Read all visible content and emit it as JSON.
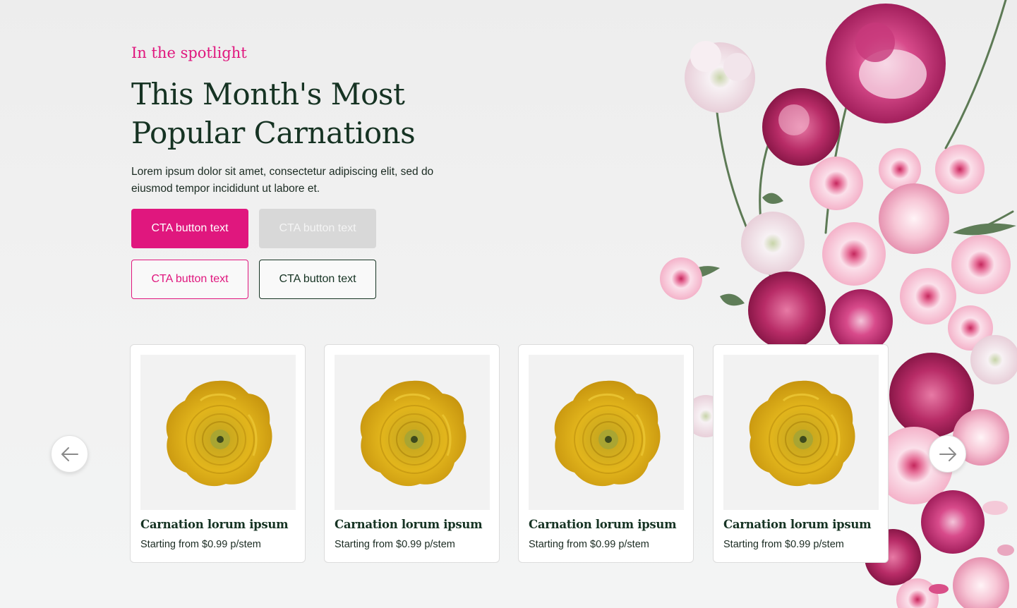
{
  "hero": {
    "eyebrow": "In the spotlight",
    "headline": "This Month's Most Popular Carnations",
    "description": "Lorem ipsum dolor sit amet, consectetur adipiscing elit, sed do eiusmod tempor incididunt ut labore et."
  },
  "buttons": {
    "primary": "CTA button text",
    "disabled": "CTA button text",
    "outline_pink": "CTA button text",
    "outline_dark": "CTA button text"
  },
  "carousel": {
    "prev_icon": "arrow-left-icon",
    "next_icon": "arrow-right-icon",
    "cards": [
      {
        "title": "Carnation lorum ipsum",
        "price": "Starting from $0.99 p/stem",
        "image": "yellow-ranunculus"
      },
      {
        "title": "Carnation lorum ipsum",
        "price": "Starting from $0.99 p/stem",
        "image": "yellow-ranunculus"
      },
      {
        "title": "Carnation lorum ipsum",
        "price": "Starting from $0.99 p/stem",
        "image": "yellow-ranunculus"
      },
      {
        "title": "Carnation lorum ipsum",
        "price": "Starting from $0.99 p/stem",
        "image": "yellow-ranunculus"
      }
    ]
  },
  "colors": {
    "accent": "#e0177e",
    "heading": "#163323",
    "disabled_bg": "#d8d8d8",
    "card_image_bg": "#f2f2f2"
  }
}
